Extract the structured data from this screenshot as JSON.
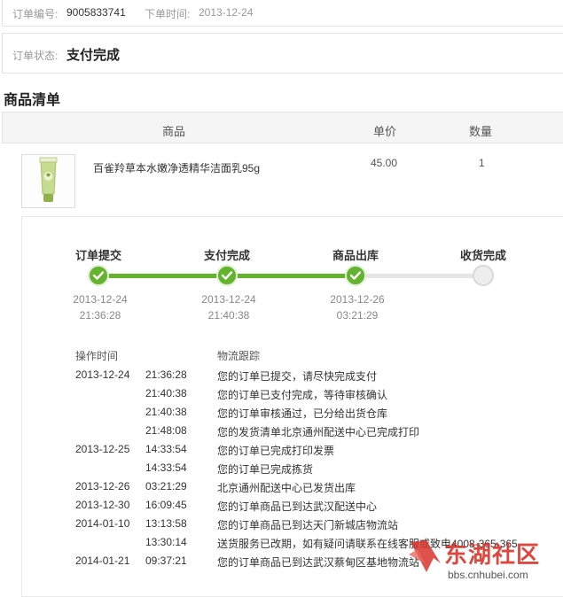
{
  "order": {
    "number_label": "订单编号:",
    "number": "9005833741",
    "time_label": "下单时间:",
    "time": "2013-12-24",
    "status_label": "订单状态:",
    "status": "支付完成"
  },
  "goods": {
    "title": "商品清单",
    "columns": [
      "商品",
      "单价",
      "数量"
    ],
    "item": {
      "name": "百雀羚草本水嫩净透精华洁面乳95g",
      "price": "45.00",
      "qty": "1"
    }
  },
  "progress": {
    "steps": [
      {
        "title": "订单提交",
        "date": "2013-12-24",
        "time": "21:36:28",
        "done": true
      },
      {
        "title": "支付完成",
        "date": "2013-12-24",
        "time": "21:40:38",
        "done": true
      },
      {
        "title": "商品出库",
        "date": "2013-12-26",
        "time": "03:21:29",
        "done": true
      },
      {
        "title": "收货完成",
        "date": "",
        "time": "",
        "done": false
      }
    ],
    "colors": {
      "done": "#63b32e",
      "todo": "#e6e6e6"
    }
  },
  "logistics": {
    "headers": [
      "操作时间",
      "物流跟踪"
    ],
    "rows": [
      {
        "date": "2013-12-24",
        "time": "21:36:28",
        "text": "您的订单已提交，请尽快完成支付"
      },
      {
        "date": "",
        "time": "21:40:38",
        "text": "您的订单已支付完成，等待审核确认"
      },
      {
        "date": "",
        "time": "21:40:38",
        "text": "您的订单审核通过，已分给出货仓库"
      },
      {
        "date": "",
        "time": "21:48:08",
        "text": "您的发货清单北京通州配送中心已完成打印"
      },
      {
        "date": "2013-12-25",
        "time": "14:33:54",
        "text": "您的订单已完成打印发票"
      },
      {
        "date": "",
        "time": "14:33:54",
        "text": "您的订单已完成拣货"
      },
      {
        "date": "2013-12-26",
        "time": "03:21:29",
        "text": "北京通州配送中心已发货出库"
      },
      {
        "date": "2013-12-30",
        "time": "16:09:45",
        "text": "您的订单商品已到达武汉配送中心"
      },
      {
        "date": "2014-01-10",
        "time": "13:13:58",
        "text": "您的订单商品已到达天门新城店物流站"
      },
      {
        "date": "",
        "time": "13:30:14",
        "text": "送货服务已改期，如有疑问请联系在线客服或致电4008-365-365"
      },
      {
        "date": "2014-01-21",
        "time": "09:37:21",
        "text": "您的订单商品已到达武汉蔡甸区基地物流站"
      }
    ]
  },
  "watermark": {
    "brand": "东湖社区",
    "url": "bbs.cnhubei.com",
    "color": "#d9342b"
  }
}
